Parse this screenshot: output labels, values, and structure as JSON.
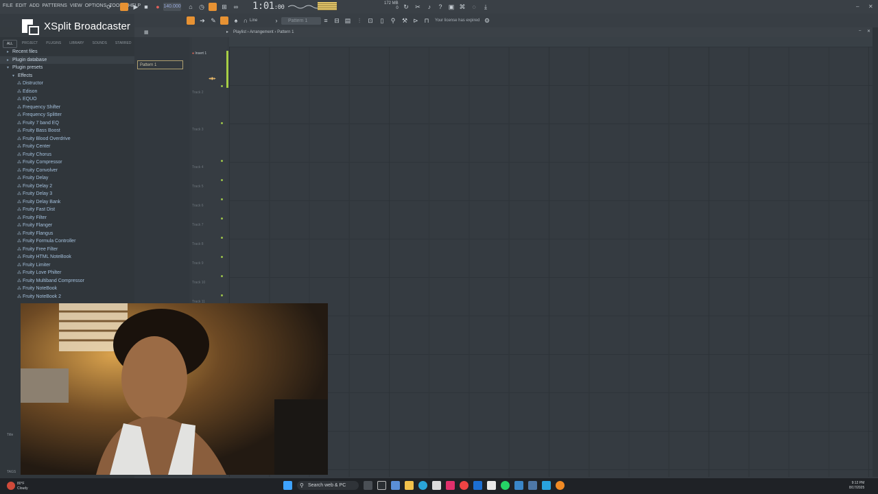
{
  "menu": [
    "FILE",
    "EDIT",
    "ADD",
    "PATTERNS",
    "VIEW",
    "OPTIONS",
    "TOOLS",
    "HELP"
  ],
  "transport": {
    "tempo": "140.000",
    "time": "1:01",
    "time_sub": "00",
    "memory": "172 MB",
    "cpu_value": "0"
  },
  "toolbar": {
    "snap": "Line",
    "pattern_selector": "Pattern 1",
    "license_notice": "Your license has expired"
  },
  "overlay": {
    "brand": "XSplit Broadcaster"
  },
  "browser": {
    "tabs": [
      "ALL",
      "PROJECT",
      "PLUGINS",
      "LIBRARY",
      "SOUNDS",
      "STARRED"
    ],
    "folders": [
      "Recent files",
      "Plugin database",
      "Plugin presets"
    ],
    "effects_folder": "Effects",
    "effects": [
      "Distructor",
      "Edison",
      "EQUO",
      "Frequency Shifter",
      "Frequency Splitter",
      "Fruity 7 band EQ",
      "Fruity Bass Boost",
      "Fruity Blood Overdrive",
      "Fruity Center",
      "Fruity Chorus",
      "Fruity Compressor",
      "Fruity Convolver",
      "Fruity Delay",
      "Fruity Delay 2",
      "Fruity Delay 3",
      "Fruity Delay Bank",
      "Fruity Fast Dist",
      "Fruity Filter",
      "Fruity Flanger",
      "Fruity Flangus",
      "Fruity Formula Controller",
      "Fruity Free Filter",
      "Fruity HTML NoteBook",
      "Fruity Limiter",
      "Fruity Love Philter",
      "Fruity Multiband Compressor",
      "Fruity NoteBook",
      "Fruity NoteBook 2"
    ],
    "title_label": "Title",
    "tags_label": "TAGS"
  },
  "playlist": {
    "breadcrumb": [
      "Playlist",
      "Arrangement",
      "Pattern 1"
    ],
    "pattern_item": "Pattern 1",
    "insert_label": "Insert 1",
    "tracks": [
      "Track 2",
      "Track 3",
      "Track 4",
      "Track 5",
      "Track 6",
      "Track 7",
      "Track 8",
      "Track 9",
      "Track 10",
      "Track 11"
    ]
  },
  "taskbar": {
    "weather_temp": "80°F",
    "weather_desc": "Cloudy",
    "search_placeholder": "Search web & PC",
    "time": "9:12 PM",
    "date": "8/17/2025"
  },
  "colors": {
    "accent_orange": "#e79233",
    "playhead_green": "#a7cf45",
    "panel_bg": "#353b41"
  }
}
